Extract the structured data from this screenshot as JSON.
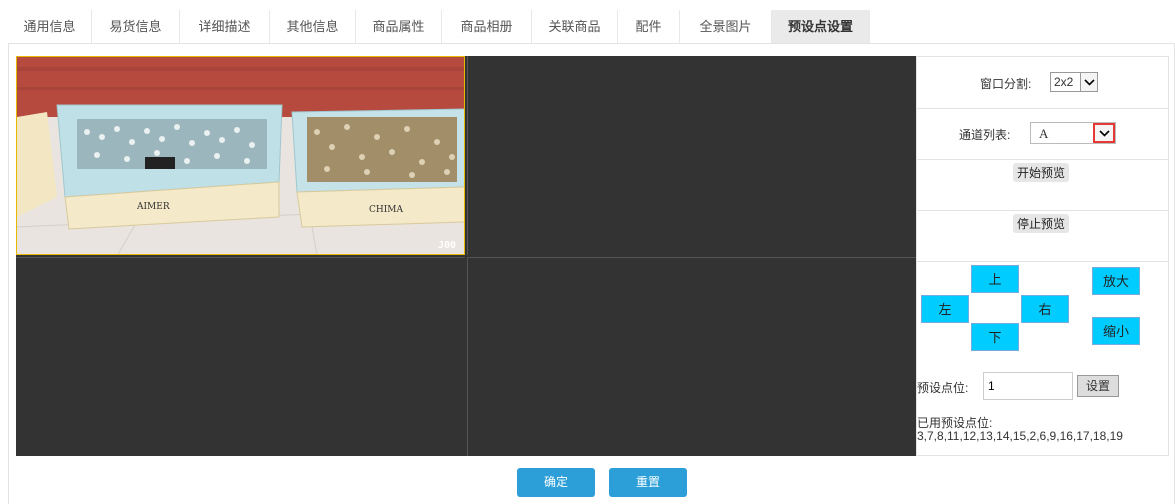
{
  "tabs": [
    {
      "label": "通用信息",
      "active": false
    },
    {
      "label": "易货信息",
      "active": false
    },
    {
      "label": "详细描述",
      "active": false
    },
    {
      "label": "其他信息",
      "active": false
    },
    {
      "label": "商品属性",
      "active": false
    },
    {
      "label": "商品相册",
      "active": false
    },
    {
      "label": "关联商品",
      "active": false
    },
    {
      "label": "配件",
      "active": false
    },
    {
      "label": "全景图片",
      "active": false
    },
    {
      "label": "预设点设置",
      "active": true
    }
  ],
  "video": {
    "camera_label": "J00",
    "selected_cell": 1,
    "highlight_color": "#e6b800"
  },
  "controls": {
    "window_split_label": "窗口分割:",
    "window_split_value": "2x2",
    "channel_list_label": "通道列表:",
    "channel_value": "A",
    "start_preview": "开始预览",
    "stop_preview": "停止预览",
    "ptz": {
      "up": "上",
      "down": "下",
      "left": "左",
      "right": "右",
      "zoom_in": "放大",
      "zoom_out": "缩小"
    },
    "preset_label": "预设点位:",
    "preset_value": "1",
    "set_button": "设置",
    "used_presets_label": "已用预设点位:",
    "used_presets_value": "3,7,8,11,12,13,14,15,2,6,9,16,17,18,19"
  },
  "footer": {
    "confirm": "确定",
    "reset": "重置"
  },
  "colors": {
    "ptz_button": "#00ccff",
    "primary_button": "#2c9fd8",
    "highlight": "#e53935"
  }
}
